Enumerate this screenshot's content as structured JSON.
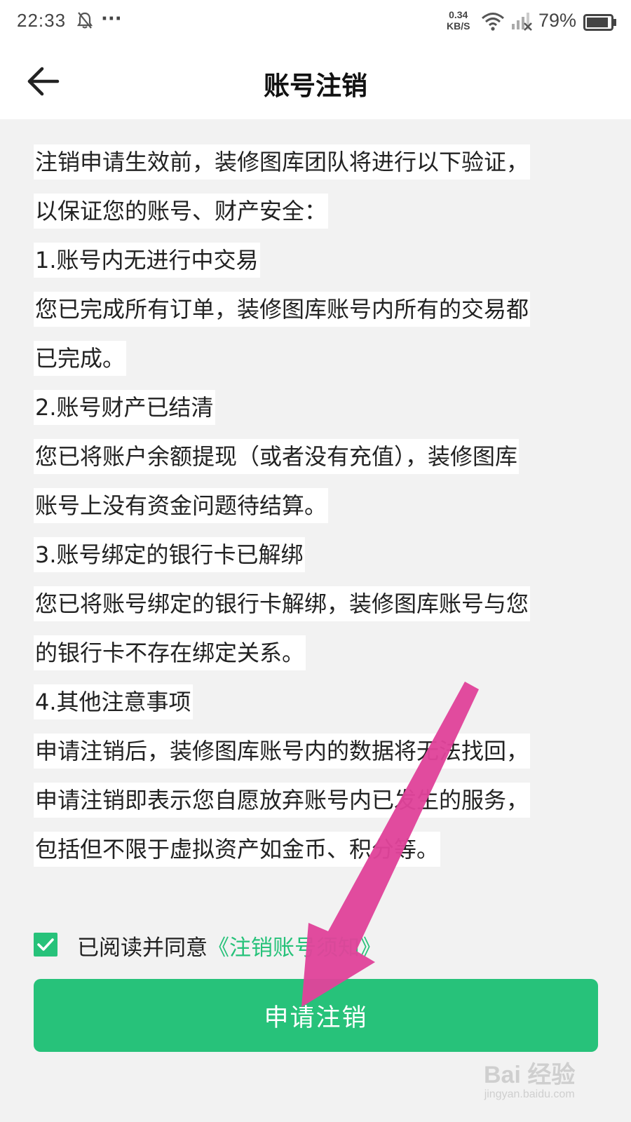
{
  "status_bar": {
    "time": "22:33",
    "dots": "···",
    "net_speed_value": "0.34",
    "net_speed_unit": "KB/S",
    "battery_percent": "79%"
  },
  "header": {
    "title": "账号注销"
  },
  "content": {
    "lines": [
      "注销申请生效前，装修图库团队将进行以下验证，",
      "以保证您的账号、财产安全：",
      "1.账号内无进行中交易",
      "您已完成所有订单，装修图库账号内所有的交易都",
      "已完成。",
      "2.账号财产已结清",
      "您已将账户余额提现（或者没有充值），装修图库",
      "账号上没有资金问题待结算。",
      "3.账号绑定的银行卡已解绑",
      "您已将账号绑定的银行卡解绑，装修图库账号与您",
      "的银行卡不存在绑定关系。",
      "4.其他注意事项",
      "申请注销后，装修图库账号内的数据将无法找回，",
      "申请注销即表示您自愿放弃账号内已发生的服务，",
      "包括但不限于虚拟资产如金币、积分等。"
    ]
  },
  "agreement": {
    "label": "已阅读并同意",
    "link_text": "《注销账号须知》",
    "checked": true
  },
  "submit": {
    "label": "申请注销"
  },
  "watermark": {
    "main": "Bai 经验",
    "sub": "jingyan.baidu.com"
  },
  "colors": {
    "accent": "#27c27a",
    "arrow": "#e0449a"
  }
}
